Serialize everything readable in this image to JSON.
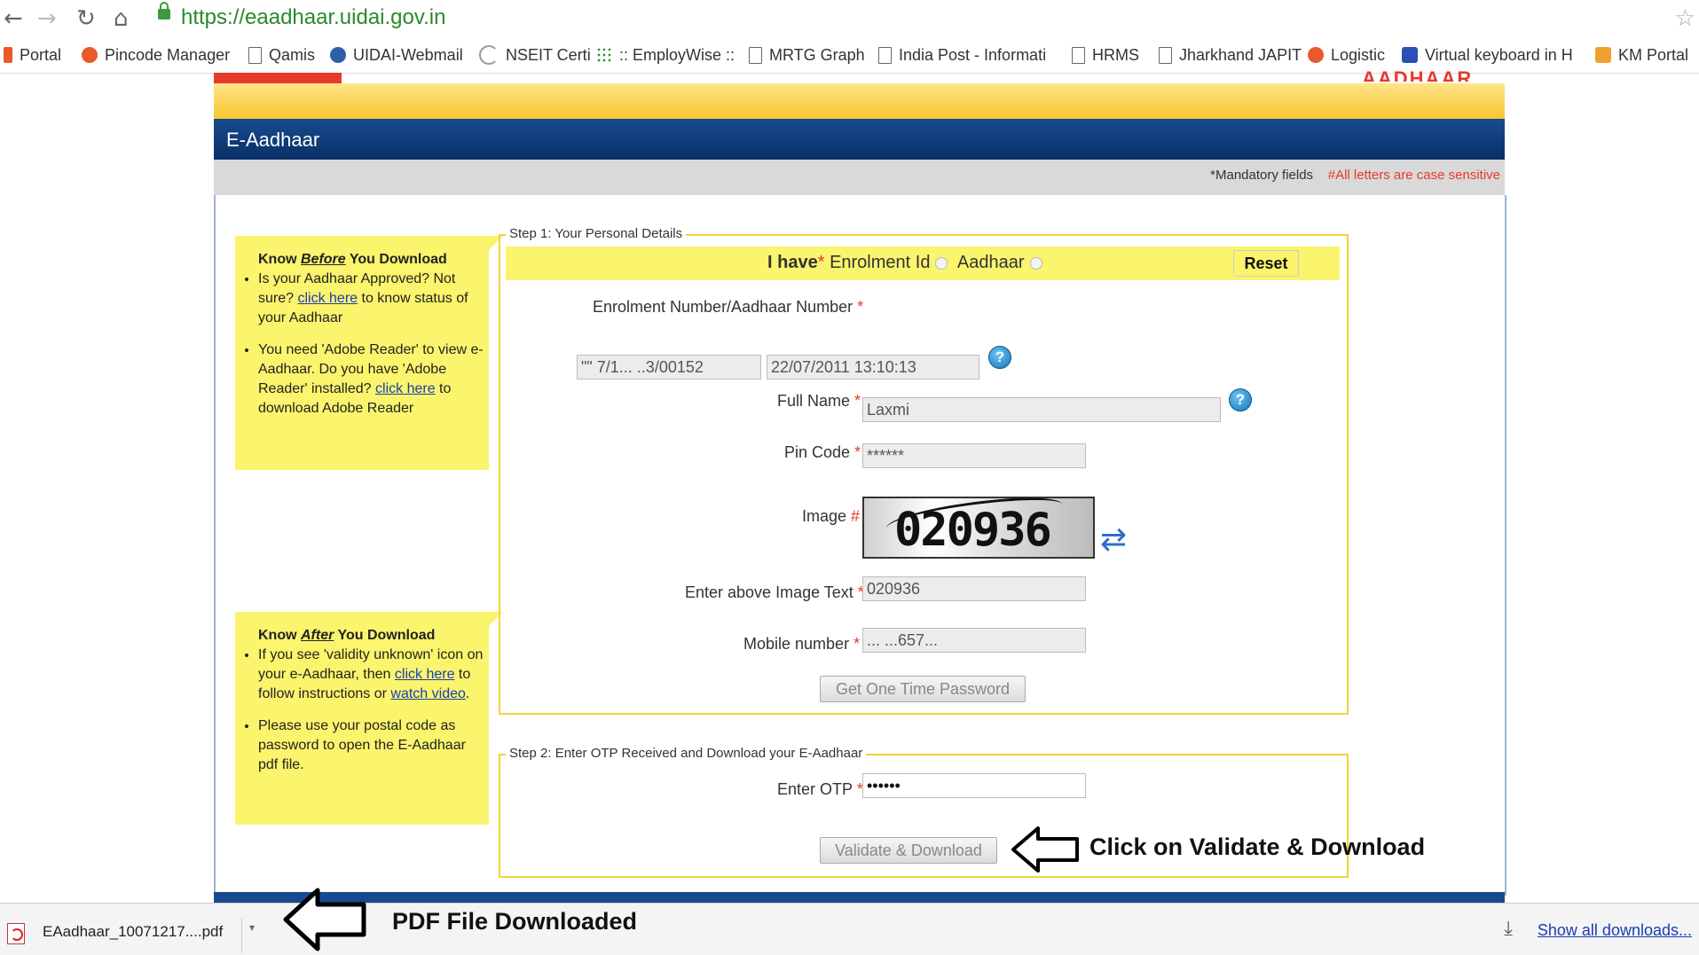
{
  "browser": {
    "url": "https://eaadhaar.uidai.gov.in",
    "back": "←",
    "forward": "→",
    "reload": "↻",
    "home": "⌂",
    "star": "☆"
  },
  "bookmarks": [
    {
      "label": "Portal",
      "icon": "grey-portal-icon"
    },
    {
      "label": "Pincode Manager",
      "icon": "orange-circle-icon"
    },
    {
      "label": "Qamis",
      "icon": "page-icon"
    },
    {
      "label": "UIDAI-Webmail",
      "icon": "blue-drop-icon"
    },
    {
      "label": "NSEIT Certi",
      "icon": "loading-icon"
    },
    {
      "label": ":: EmployWise ::",
      "icon": "dots-icon"
    },
    {
      "label": "MRTG Graph",
      "icon": "page-icon"
    },
    {
      "label": "India Post - Informati",
      "icon": "page-icon"
    },
    {
      "label": "HRMS",
      "icon": "page-icon"
    },
    {
      "label": "Jharkhand JAPIT",
      "icon": "page-icon"
    },
    {
      "label": "Logistic",
      "icon": "orange-circle-icon"
    },
    {
      "label": "Virtual keyboard in H",
      "icon": "keyboard-icon"
    },
    {
      "label": "KM Portal",
      "icon": "km-icon"
    }
  ],
  "site": {
    "logo_text": "AADHAAR",
    "title": "E-Aadhaar",
    "mandatory_note": "*Mandatory fields",
    "case_note": "#All letters are case sensitive"
  },
  "know_before": {
    "heading_pre": "Know ",
    "heading_em": "Before",
    "heading_post": " You Download",
    "item1_a": "Is your Aadhaar Approved? Not sure? ",
    "item1_link": "click here",
    "item1_b": " to know status of your Aadhaar",
    "item2_a": "You need 'Adobe Reader' to view e-Aadhaar. Do you have 'Adobe Reader' installed? ",
    "item2_link": "click here",
    "item2_b": " to download Adobe Reader"
  },
  "know_after": {
    "heading_pre": "Know ",
    "heading_em": "After",
    "heading_post": " You Download",
    "item1_a": "If you see 'validity unknown' icon on your e-Aadhaar, then ",
    "item1_link": "click here",
    "item1_b": " to follow instructions or ",
    "item1_link2": "watch video",
    "item1_c": ".",
    "item2": "Please use your postal code as password to open the E-Aadhaar pdf file."
  },
  "step1": {
    "legend": "Step 1: Your Personal Details",
    "i_have": "I have",
    "opt_enrolment": "Enrolment Id",
    "opt_aadhaar": "Aadhaar",
    "reset": "Reset",
    "enrol_label": "Enrolment Number/Aadhaar Number",
    "enrol_value": "\"\" 7/1... ..3/00152",
    "datetime_value": "22/07/2011 13:10:13",
    "fullname_label": "Full Name",
    "fullname_value": "Laxmi",
    "pincode_label": "Pin Code",
    "pincode_value": "******",
    "image_label": "Image",
    "captcha": "020936",
    "image_text_label": "Enter above Image Text",
    "image_text_value": "020936",
    "mobile_label": "Mobile number",
    "mobile_value": "... ...657...",
    "get_otp": "Get One Time Password"
  },
  "step2": {
    "legend": "Step 2: Enter OTP Received and Download your E-Aadhaar",
    "otp_label": "Enter OTP",
    "otp_value": "••••••",
    "validate": "Validate & Download"
  },
  "annotations": {
    "validate_hint": "Click on Validate & Download",
    "pdf_hint": "PDF File Downloaded"
  },
  "downloads": {
    "file": "EAadhaar_10071217....pdf",
    "show_all": "Show all downloads..."
  }
}
